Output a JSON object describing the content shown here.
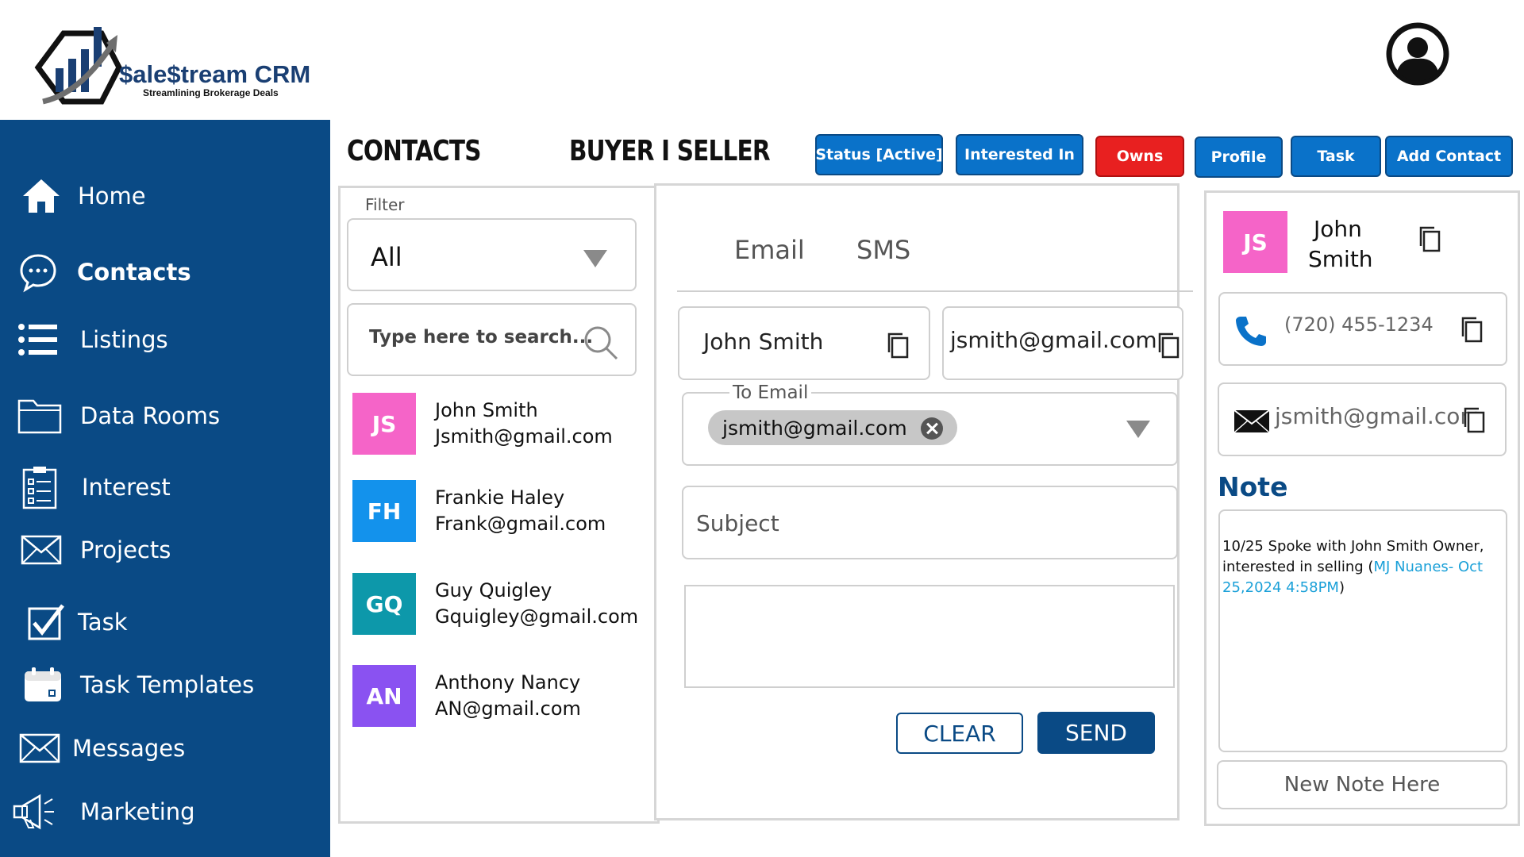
{
  "brand": {
    "name": "$ale$tream CRM",
    "tagline": "Streamlining Brokerage Deals"
  },
  "sidebar": {
    "items": [
      {
        "label": "Home",
        "icon": "home-icon"
      },
      {
        "label": "Contacts",
        "icon": "chat-icon",
        "active": true
      },
      {
        "label": "Listings",
        "icon": "list-icon"
      },
      {
        "label": "Data Rooms",
        "icon": "folder-icon"
      },
      {
        "label": "Interest",
        "icon": "clipboard-icon"
      },
      {
        "label": "Projects",
        "icon": "envelope-icon"
      },
      {
        "label": "Task",
        "icon": "checkbox-icon"
      },
      {
        "label": "Task Templates",
        "icon": "calendar-icon"
      },
      {
        "label": "Messages",
        "icon": "envelope-icon"
      },
      {
        "label": "Marketing",
        "icon": "megaphone-icon"
      }
    ]
  },
  "header": {
    "contacts_heading": "CONTACTS",
    "buyer_seller_heading": "BUYER I SELLER",
    "buttons": {
      "status": "Status [Active]",
      "interested": "Interested In",
      "owns": "Owns",
      "profile": "Profile",
      "task": "Task",
      "add_contact": "Add Contact"
    }
  },
  "contact_list": {
    "filter_label": "Filter",
    "filter_value": "All",
    "search_placeholder": "Type here to search...",
    "contacts": [
      {
        "initials": "JS",
        "name": "John Smith",
        "email": "Jsmith@gmail.com",
        "color": "#f564c8"
      },
      {
        "initials": "FH",
        "name": "Frankie Haley",
        "email": "Frank@gmail.com",
        "color": "#1392ec"
      },
      {
        "initials": "GQ",
        "name": "Guy Quigley",
        "email": "Gquigley@gmail.com",
        "color": "#0d98aa"
      },
      {
        "initials": "AN",
        "name": "Anthony Nancy",
        "email": "AN@gmail.com",
        "color": "#8a52f1"
      }
    ]
  },
  "composer": {
    "tabs": [
      "Email",
      "SMS"
    ],
    "from_name": "John Smith",
    "from_email": "jsmith@gmail.com",
    "to_label": "To Email",
    "to_chip": "jsmith@gmail.com",
    "subject_placeholder": "Subject",
    "clear_label": "CLEAR",
    "send_label": "SEND"
  },
  "profile": {
    "initials": "JS",
    "first_name": "John",
    "last_name": "Smith",
    "phone": "(720) 455-1234",
    "email": "jsmith@gmail.com",
    "note_title": "Note",
    "note_text": "10/25 Spoke with John Smith Owner, interested in selling (",
    "note_meta": "MJ Nuanes- Oct 25,2024 4:58PM",
    "note_close": ")",
    "new_note_placeholder": "New Note Here"
  },
  "colors": {
    "sidebar": "#0a4a85",
    "button_blue": "#0a72c9",
    "button_red": "#e82020",
    "note_title": "#0a4a85"
  }
}
